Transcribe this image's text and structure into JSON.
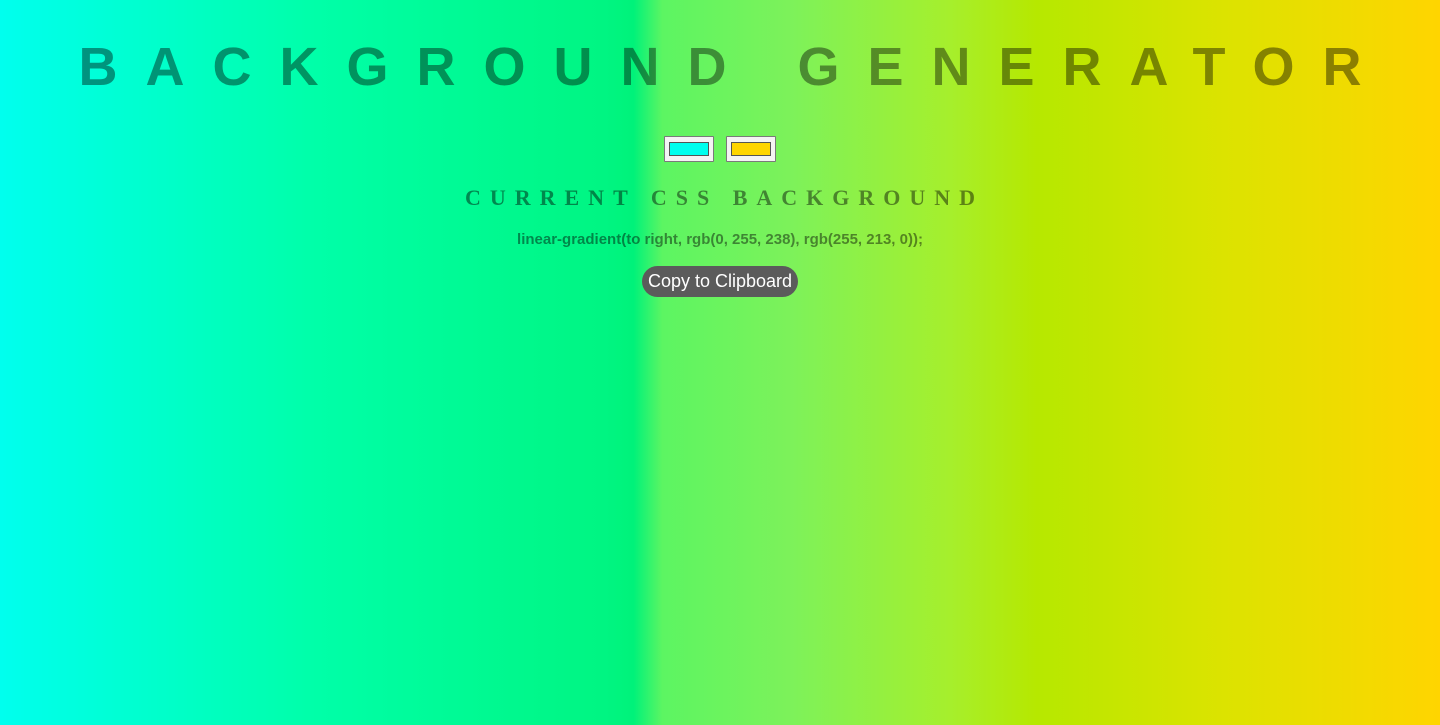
{
  "header": {
    "title": "BACKGROUND GENERATOR"
  },
  "pickers": {
    "color1": "#00ffee",
    "color2": "#ffd500"
  },
  "result": {
    "heading": "CURRENT CSS BACKGROUND",
    "css_value": "linear-gradient(to right, rgb(0, 255, 238), rgb(255, 213, 0));"
  },
  "actions": {
    "copy_label": "Copy to Clipboard"
  },
  "colors": {
    "gradient_start": "#00ffee",
    "gradient_end": "#ffd500",
    "button_bg": "#5b5b5b"
  }
}
